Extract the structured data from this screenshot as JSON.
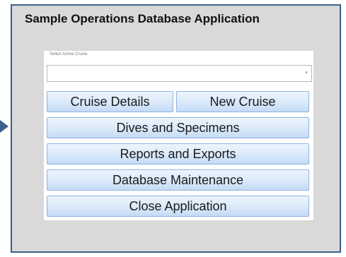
{
  "window": {
    "title": "Sample Operations Database Application"
  },
  "menu": {
    "select_label": "Select Active Cruise",
    "select_value": "",
    "buttons": {
      "cruise_details": "Cruise Details",
      "new_cruise": "New Cruise",
      "dives_specimens": "Dives and Specimens",
      "reports_exports": "Reports and Exports",
      "database_maintenance": "Database Maintenance",
      "close_application": "Close Application"
    }
  },
  "colors": {
    "frame_border": "#3e5f8a",
    "panel_background": "#d9d9d9",
    "button_border": "#8eb3df"
  }
}
